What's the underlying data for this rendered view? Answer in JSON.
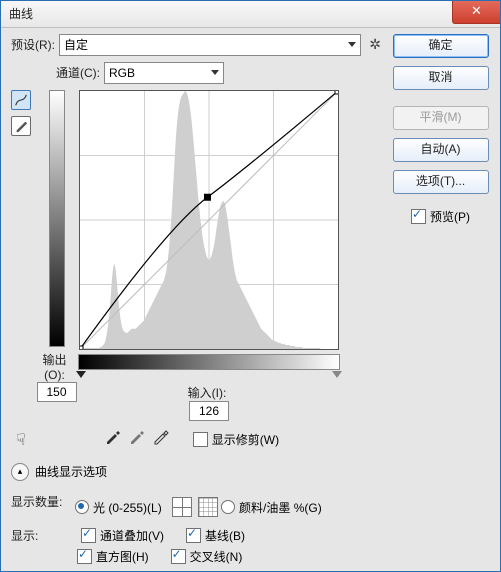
{
  "window": {
    "title": "曲线",
    "close_glyph": "✕"
  },
  "preset": {
    "label": "预设(R):",
    "value": "自定"
  },
  "channel": {
    "label": "通道(C):",
    "value": "RGB"
  },
  "output": {
    "label": "输出(O):",
    "value": "150"
  },
  "input": {
    "label": "输入(I):",
    "value": "126"
  },
  "show_clip": {
    "label": "显示修剪(W)",
    "checked": false
  },
  "section_title": "曲线显示选项",
  "show_amount": {
    "label": "显示数量:",
    "light": {
      "label": "光 (0-255)(L)",
      "checked": true
    },
    "pigment": {
      "label": "颜料/油墨 %(G)",
      "checked": false
    }
  },
  "show": {
    "label": "显示:",
    "overlay": {
      "label": "通道叠加(V)",
      "checked": true
    },
    "baseline": {
      "label": "基线(B)",
      "checked": true
    },
    "histogram": {
      "label": "直方图(H)",
      "checked": true
    },
    "intersect": {
      "label": "交叉线(N)",
      "checked": true
    }
  },
  "buttons": {
    "ok": "确定",
    "cancel": "取消",
    "smooth": "平滑(M)",
    "auto": "自动(A)",
    "options": "选项(T)..."
  },
  "preview": {
    "label": "预览(P)",
    "checked": true
  },
  "chart_data": {
    "type": "curve",
    "title": "",
    "xlabel": "输入",
    "ylabel": "输出",
    "xlim": [
      0,
      255
    ],
    "ylim": [
      0,
      255
    ],
    "grid": "4x4",
    "control_points": [
      {
        "x": 0,
        "y": 0
      },
      {
        "x": 126,
        "y": 150
      },
      {
        "x": 255,
        "y": 255
      }
    ],
    "baseline": [
      {
        "x": 0,
        "y": 0
      },
      {
        "x": 255,
        "y": 255
      }
    ],
    "histogram": [
      0,
      0,
      0,
      0,
      1,
      1,
      1,
      1,
      1,
      1,
      1,
      1,
      1,
      1,
      1,
      1,
      1,
      1,
      1,
      1,
      2,
      2,
      3,
      4,
      5,
      8,
      12,
      18,
      25,
      35,
      48,
      62,
      74,
      82,
      84,
      80,
      72,
      60,
      48,
      38,
      30,
      24,
      20,
      18,
      17,
      16,
      16,
      16,
      17,
      18,
      19,
      20,
      20,
      20,
      20,
      20,
      21,
      22,
      23,
      24,
      25,
      26,
      27,
      28,
      30,
      32,
      34,
      36,
      38,
      40,
      42,
      44,
      46,
      48,
      50,
      52,
      54,
      56,
      58,
      60,
      62,
      64,
      66,
      68,
      72,
      76,
      82,
      90,
      100,
      112,
      126,
      142,
      160,
      178,
      196,
      212,
      224,
      234,
      241,
      246,
      249,
      251,
      252,
      254,
      255,
      254,
      252,
      248,
      243,
      236,
      228,
      218,
      208,
      196,
      184,
      172,
      160,
      148,
      138,
      128,
      120,
      112,
      106,
      100,
      96,
      92,
      90,
      88,
      88,
      90,
      92,
      96,
      100,
      106,
      112,
      120,
      126,
      132,
      138,
      142,
      144,
      146,
      146,
      144,
      140,
      134,
      128,
      120,
      112,
      104,
      96,
      88,
      82,
      76,
      72,
      68,
      66,
      64,
      62,
      60,
      58,
      56,
      54,
      52,
      50,
      48,
      46,
      44,
      42,
      40,
      38,
      36,
      34,
      32,
      30,
      28,
      26,
      24,
      22,
      20,
      19,
      18,
      17,
      16,
      15,
      14,
      13,
      12,
      11,
      10,
      9,
      9,
      8,
      8,
      7,
      7,
      6,
      6,
      6,
      5,
      5,
      5,
      5,
      4,
      4,
      4,
      4,
      4,
      3,
      3,
      3,
      3,
      3,
      2,
      2,
      2,
      2,
      2,
      2,
      2,
      1,
      1,
      1,
      1,
      1,
      1,
      1,
      1,
      1,
      1,
      1,
      1,
      1,
      1,
      1,
      1,
      1,
      1,
      0,
      0,
      0,
      0,
      0,
      0,
      0,
      0,
      0,
      0,
      0,
      0,
      0,
      0,
      0,
      0,
      0,
      0
    ]
  }
}
